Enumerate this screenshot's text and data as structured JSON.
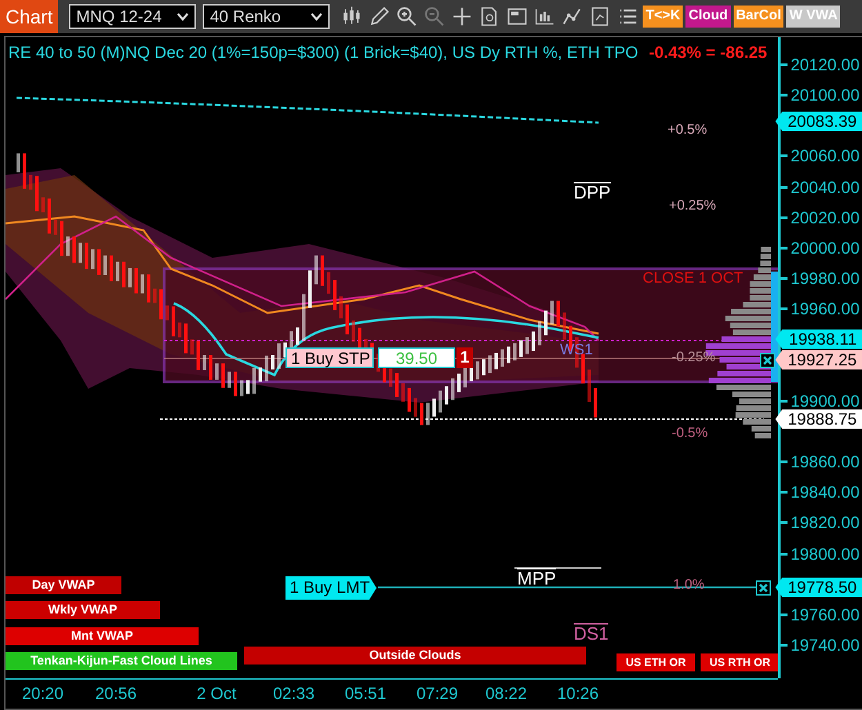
{
  "toolbar": {
    "title": "Chart",
    "instrument": "MNQ 12-24",
    "bar_type": "40 Renko",
    "toggles": [
      {
        "label": "T<>K",
        "color": "#f5901e"
      },
      {
        "label": "Cloud",
        "color": "#c2188c"
      },
      {
        "label": "BarCol",
        "color": "#f5901e"
      },
      {
        "label": "W VWA",
        "color": "#c8c8c8"
      }
    ]
  },
  "chart": {
    "header": "RE 40 to 50 (M)NQ Dec 20 (1%=150p=$300) (1 Brick=$40), US Dy RTH %, ETH TPO",
    "change": "-0.43% = -86.25",
    "levels": [
      {
        "label": "+0.5%",
        "kind": "percent",
        "color": "#d8a8b8"
      },
      {
        "label": "DPP",
        "kind": "pivot",
        "color": "#ffffff"
      },
      {
        "label": "+0.25%",
        "kind": "percent",
        "color": "#d8a8b8"
      },
      {
        "label": "CLOSE 1 OCT",
        "kind": "note",
        "color": "#e01010"
      },
      {
        "label": "WS1",
        "kind": "note",
        "color": "#7a7ae0"
      },
      {
        "label": "-0.25%",
        "kind": "percent",
        "color": "#b89098"
      },
      {
        "label": "-0.5%",
        "kind": "percent",
        "color": "#c06080"
      },
      {
        "label": "MPP",
        "kind": "pivot",
        "color": "#ffffff"
      },
      {
        "label": "1.0%",
        "kind": "percent",
        "color": "#c06080"
      },
      {
        "label": "DS1",
        "kind": "pivot",
        "color": "#d060a0"
      }
    ],
    "orders": [
      {
        "label": "1 Buy STP",
        "kind": "stop",
        "price": "39.50",
        "quantity": "1"
      },
      {
        "label": "1 Buy LMT",
        "kind": "limit"
      }
    ],
    "legend": [
      {
        "label": "Day VWAP",
        "color": "#c00000"
      },
      {
        "label": "Wkly VWAP",
        "color": "#cc0000"
      },
      {
        "label": "Mnt VWAP",
        "color": "#dd0000"
      },
      {
        "label": "Tenkan-Kijun-Fast Cloud Lines",
        "color": "#22c41e"
      },
      {
        "label": "Outside Clouds",
        "color": "#c40000"
      },
      {
        "label": "US ETH OR",
        "color": "#dd0000"
      },
      {
        "label": "US RTH OR",
        "color": "#dd0000"
      }
    ],
    "price_axis": {
      "ticks": [
        "20120.00",
        "20100.00",
        "20060.00",
        "20040.00",
        "20020.00",
        "20000.00",
        "19980.00",
        "19960.00",
        "19900.00",
        "19860.00",
        "19840.00",
        "19820.00",
        "19800.00",
        "19760.00",
        "19740.00"
      ],
      "markers": [
        {
          "label": "20083.39",
          "color": "#00e8f0"
        },
        {
          "label": "19938.11",
          "color": "#00e8f0"
        },
        {
          "label": "19927.25",
          "color": "#ffc8c8"
        },
        {
          "label": "19888.75",
          "color": "#ffffff"
        },
        {
          "label": "19778.50",
          "color": "#00e8f0"
        }
      ]
    },
    "time_axis": [
      "20:20",
      "20:56",
      "2 Oct",
      "02:33",
      "05:51",
      "07:29",
      "08:22",
      "10:26"
    ]
  }
}
